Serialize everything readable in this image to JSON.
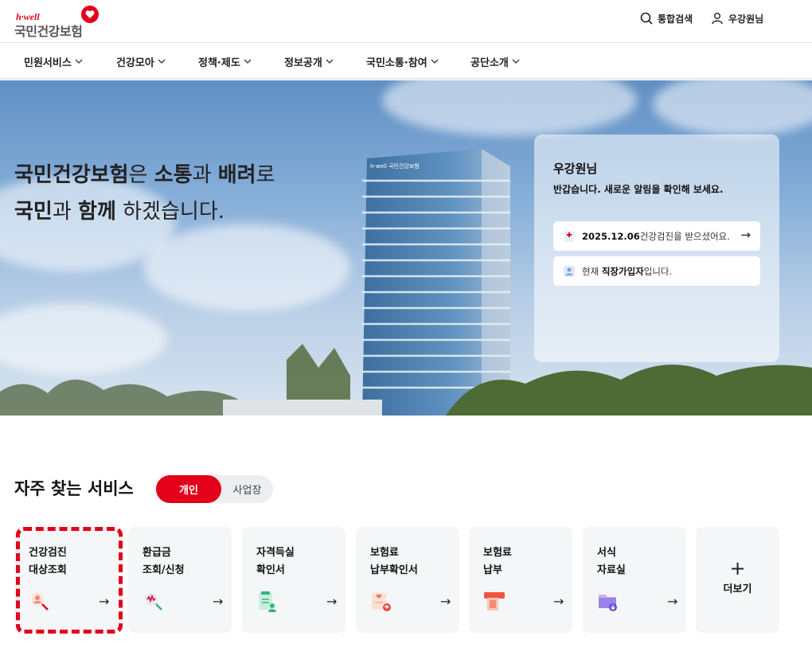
{
  "brand": {
    "sub": "h·well",
    "name": "국민건강보험"
  },
  "header": {
    "search_label": "통합검색",
    "user_label": "우강원님"
  },
  "nav": {
    "items": [
      "민원서비스",
      "건강모아",
      "정책·제도",
      "정보공개",
      "국민소통·참여",
      "공단소개"
    ]
  },
  "hero": {
    "line1": {
      "b1": "국민건강보험",
      "t1": "은 ",
      "b2": "소통",
      "t2": "과 ",
      "b3": "배려",
      "t3": "로"
    },
    "line2": {
      "b1": "국민",
      "t1": "과 ",
      "b2": "함께",
      "t2": " 하겠습니다."
    },
    "building_sign": "h-well 국민건강보험"
  },
  "notice": {
    "user_name": "우강원님",
    "greeting": "반갑습니다. 새로운 알림을 확인해 보세요.",
    "checkup": {
      "date": "2025.12.06",
      "text": "건강검진을 받으셨어요."
    },
    "membership": {
      "prefix": "현재 ",
      "type": "직장가입자",
      "suffix": "입니다."
    }
  },
  "services": {
    "title": "자주 찾는 서비스",
    "tab_active": "개인",
    "tab_inactive": "사업장",
    "cards": [
      {
        "label": "건강검진\n대상조회",
        "icon": "checkup-search-icon"
      },
      {
        "label": "환급금\n조회/신청",
        "icon": "refund-search-icon"
      },
      {
        "label": "자격득실\n확인서",
        "icon": "qualification-doc-icon"
      },
      {
        "label": "보험료\n납부확인서",
        "icon": "payment-confirm-icon"
      },
      {
        "label": "보험료\n납부",
        "icon": "payment-icon"
      },
      {
        "label": "서식\n자료실",
        "icon": "forms-folder-icon"
      }
    ],
    "more_label": "더보기"
  },
  "colors": {
    "brand_red": "#e2001a",
    "card_bg": "#f5f6f7"
  }
}
